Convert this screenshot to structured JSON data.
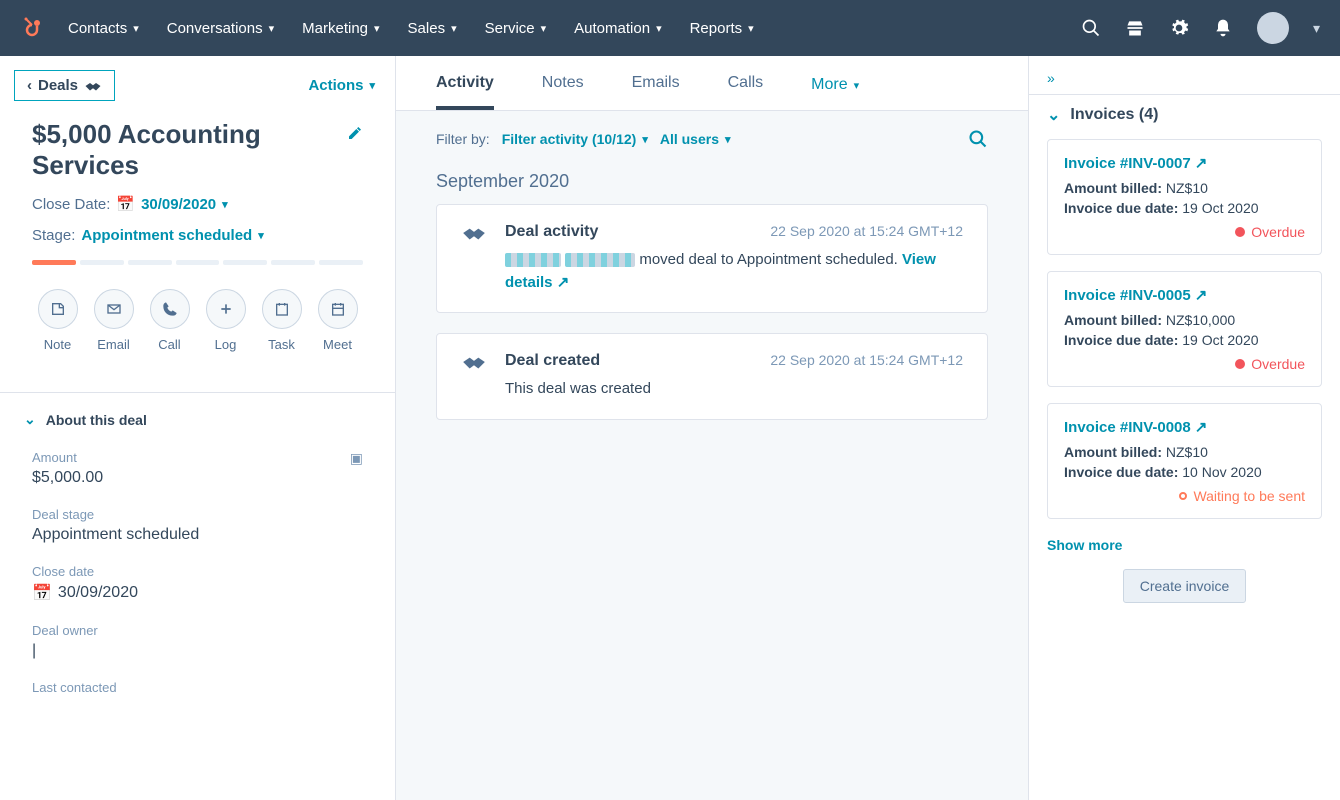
{
  "nav": {
    "items": [
      "Contacts",
      "Conversations",
      "Marketing",
      "Sales",
      "Service",
      "Automation",
      "Reports"
    ]
  },
  "back": {
    "label": "Deals"
  },
  "actions_label": "Actions",
  "deal": {
    "title": "$5,000 Accounting Services",
    "close_date_label": "Close Date:",
    "close_date": "30/09/2020",
    "stage_label": "Stage:",
    "stage": "Appointment scheduled"
  },
  "circle_actions": [
    {
      "id": "note",
      "label": "Note"
    },
    {
      "id": "email",
      "label": "Email"
    },
    {
      "id": "call",
      "label": "Call"
    },
    {
      "id": "log",
      "label": "Log"
    },
    {
      "id": "task",
      "label": "Task"
    },
    {
      "id": "meet",
      "label": "Meet"
    }
  ],
  "about_section": {
    "title": "About this deal"
  },
  "fields": {
    "amount_label": "Amount",
    "amount_value": "$5,000.00",
    "deal_stage_label": "Deal stage",
    "deal_stage_value": "Appointment scheduled",
    "close_date_label": "Close date",
    "close_date_value": "30/09/2020",
    "deal_owner_label": "Deal owner",
    "deal_owner_value": "|",
    "last_contacted_label": "Last contacted"
  },
  "tabs": [
    "Activity",
    "Notes",
    "Emails",
    "Calls"
  ],
  "more_tab": "More",
  "filter": {
    "label": "Filter by:",
    "activity": "Filter activity (10/12)",
    "users": "All users"
  },
  "month": "September 2020",
  "activities": [
    {
      "title": "Deal activity",
      "date": "22 Sep 2020 at 15:24 GMT+12",
      "text": "moved deal to Appointment scheduled.",
      "view_details": "View details"
    },
    {
      "title": "Deal created",
      "date": "22 Sep 2020 at 15:24 GMT+12",
      "text": "This deal was created"
    }
  ],
  "invoices_section": {
    "title": "Invoices (4)"
  },
  "invoices": [
    {
      "link": "Invoice #INV-0007",
      "billed_label": "Amount billed:",
      "billed_value": "NZ$10",
      "due_label": "Invoice due date:",
      "due_value": "19 Oct 2020",
      "status": "Overdue",
      "status_class": "overdue"
    },
    {
      "link": "Invoice #INV-0005",
      "billed_label": "Amount billed:",
      "billed_value": "NZ$10,000",
      "due_label": "Invoice due date:",
      "due_value": "19 Oct 2020",
      "status": "Overdue",
      "status_class": "overdue"
    },
    {
      "link": "Invoice #INV-0008",
      "billed_label": "Amount billed:",
      "billed_value": "NZ$10",
      "due_label": "Invoice due date:",
      "due_value": "10 Nov 2020",
      "status": "Waiting to be sent",
      "status_class": "waiting"
    }
  ],
  "show_more": "Show more",
  "create_invoice": "Create invoice"
}
